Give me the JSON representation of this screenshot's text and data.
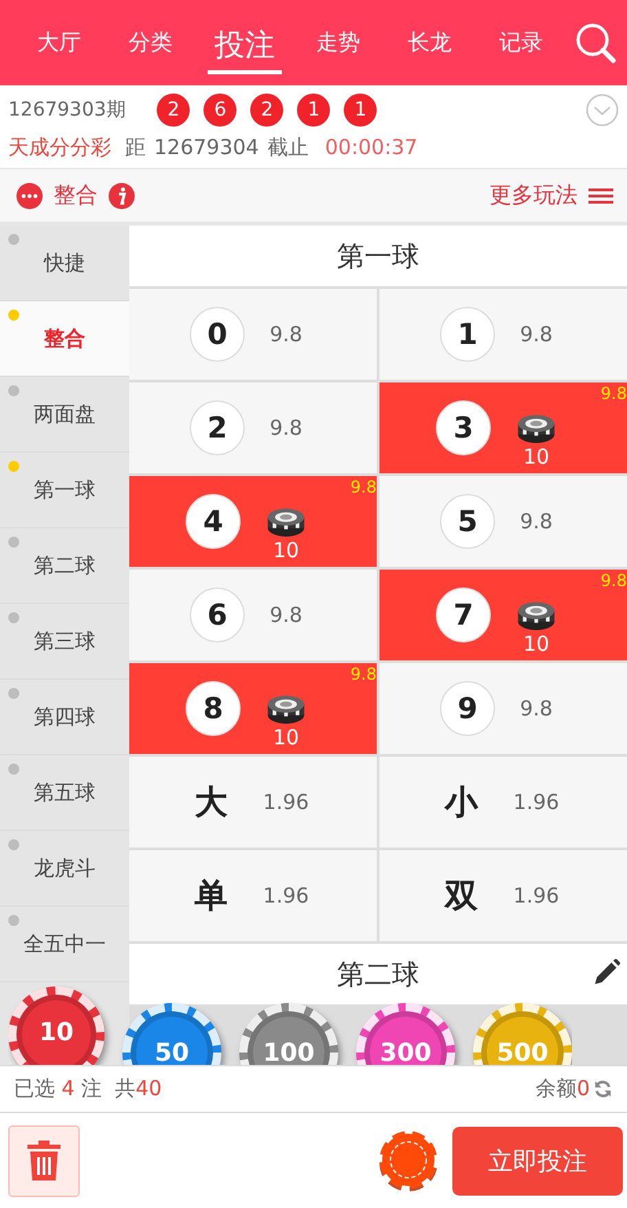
{
  "nav": {
    "tabs": [
      {
        "label": "大厅",
        "selected": false
      },
      {
        "label": "分类",
        "selected": false
      },
      {
        "label": "投注",
        "selected": true
      },
      {
        "label": "走势",
        "selected": false
      },
      {
        "label": "长龙",
        "selected": false
      },
      {
        "label": "记录",
        "selected": false
      }
    ]
  },
  "draw": {
    "period": "12679303期",
    "balls": [
      "2",
      "6",
      "2",
      "1",
      "1"
    ],
    "lottery": "天成分分彩",
    "next_prefix": "距",
    "next_period": "12679304",
    "deadline_label": "截止",
    "countdown": "00:00:37"
  },
  "play_bar": {
    "mode": "整合",
    "more": "更多玩法"
  },
  "sidebar": {
    "items": [
      {
        "label": "快捷",
        "marked": false,
        "selected": false
      },
      {
        "label": "整合",
        "marked": true,
        "selected": true
      },
      {
        "label": "两面盘",
        "marked": false,
        "selected": false
      },
      {
        "label": "第一球",
        "marked": true,
        "selected": false
      },
      {
        "label": "第二球",
        "marked": false,
        "selected": false
      },
      {
        "label": "第三球",
        "marked": false,
        "selected": false
      },
      {
        "label": "第四球",
        "marked": false,
        "selected": false
      },
      {
        "label": "第五球",
        "marked": false,
        "selected": false
      },
      {
        "label": "龙虎斗",
        "marked": false,
        "selected": false
      },
      {
        "label": "全五中一",
        "marked": false,
        "selected": false
      }
    ]
  },
  "sections": [
    {
      "title": "第一球",
      "cells": [
        {
          "kind": "number",
          "label": "0",
          "odds": "9.8",
          "selected": false
        },
        {
          "kind": "number",
          "label": "1",
          "odds": "9.8",
          "selected": false
        },
        {
          "kind": "number",
          "label": "2",
          "odds": "9.8",
          "selected": false
        },
        {
          "kind": "number",
          "label": "3",
          "odds": "9.8",
          "selected": true,
          "stake": "10"
        },
        {
          "kind": "number",
          "label": "4",
          "odds": "9.8",
          "selected": true,
          "stake": "10"
        },
        {
          "kind": "number",
          "label": "5",
          "odds": "9.8",
          "selected": false
        },
        {
          "kind": "number",
          "label": "6",
          "odds": "9.8",
          "selected": false
        },
        {
          "kind": "number",
          "label": "7",
          "odds": "9.8",
          "selected": true,
          "stake": "10"
        },
        {
          "kind": "number",
          "label": "8",
          "odds": "9.8",
          "selected": true,
          "stake": "10"
        },
        {
          "kind": "number",
          "label": "9",
          "odds": "9.8",
          "selected": false
        },
        {
          "kind": "char",
          "label": "大",
          "odds": "1.96",
          "selected": false
        },
        {
          "kind": "char",
          "label": "小",
          "odds": "1.96",
          "selected": false
        },
        {
          "kind": "char",
          "label": "单",
          "odds": "1.96",
          "selected": false
        },
        {
          "kind": "char",
          "label": "双",
          "odds": "1.96",
          "selected": false
        }
      ]
    },
    {
      "title": "第二球"
    }
  ],
  "chips": [
    {
      "value": "10",
      "color": "#e8323c",
      "selected": true
    },
    {
      "value": "50",
      "color": "#1a86e8",
      "selected": false
    },
    {
      "value": "100",
      "color": "#8a8a8a",
      "selected": false
    },
    {
      "value": "300",
      "color": "#f046b4",
      "selected": false
    },
    {
      "value": "500",
      "color": "#e8b30e",
      "selected": false
    }
  ],
  "summary": {
    "selected_label": "已选",
    "count": "4",
    "unit": "注",
    "total_label": "共",
    "total": "40",
    "balance_label": "余额",
    "balance": "0"
  },
  "submit": "立即投注"
}
